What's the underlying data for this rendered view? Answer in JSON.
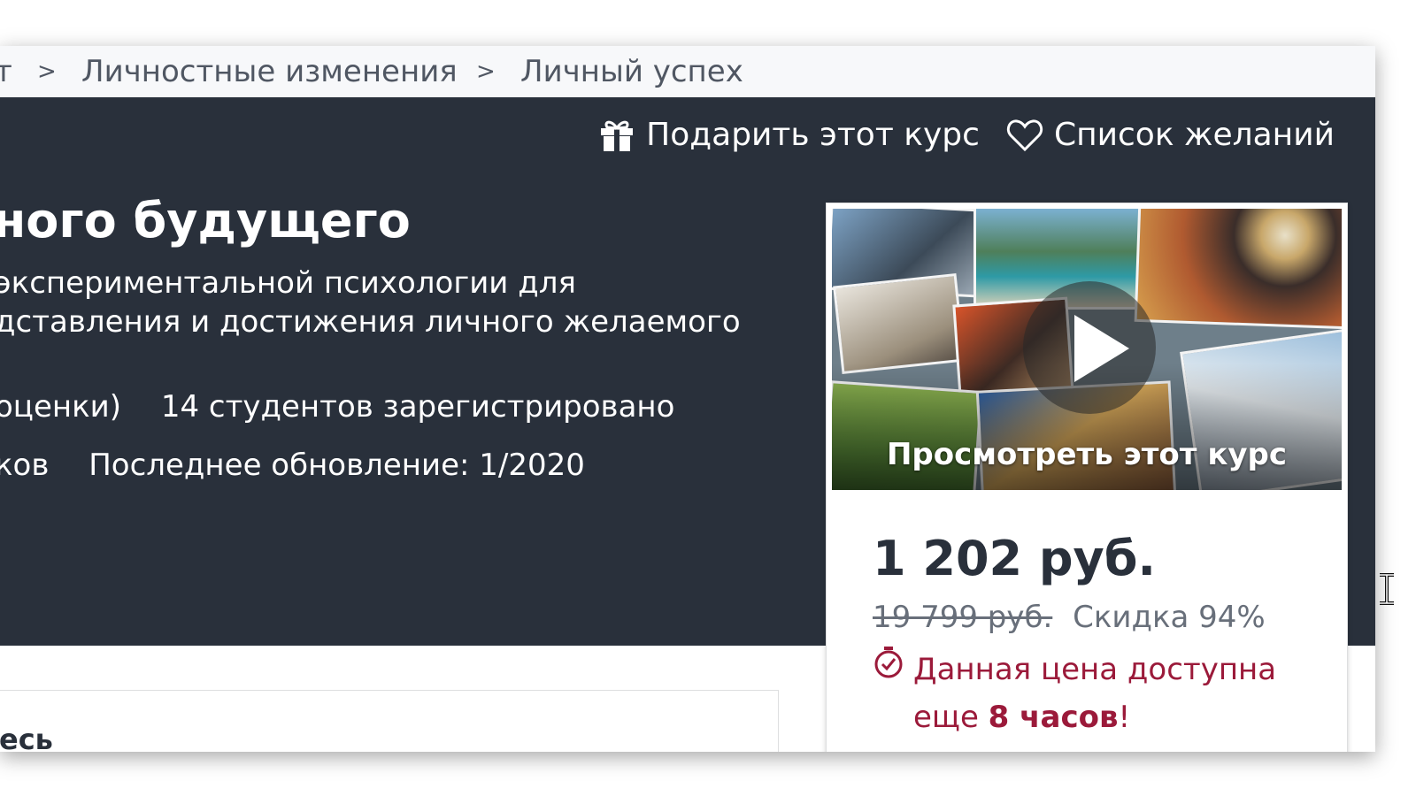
{
  "breadcrumb": {
    "items": [
      "т",
      "Личностные изменения",
      "Личный успех"
    ],
    "separator": ">"
  },
  "actions": {
    "gift_label": "Подарить этот курс",
    "wishlist_label": "Список желаний"
  },
  "course": {
    "title": "ного будущего",
    "subtitle_line1": "экспериментальной психологии для",
    "subtitle_line2": "дставления и достижения личного желаемого",
    "ratings_fragment": "оценки)",
    "students": "14 студентов зарегистрировано",
    "languages_fragment": "ков",
    "last_updated": "Последнее обновление: 1/2020"
  },
  "below": {
    "heading_fragment": "есь"
  },
  "sidebar": {
    "preview_label": "Просмотреть этот курс",
    "price": "1 202 руб.",
    "old_price": "19 799 руб.",
    "discount": "Скидка 94%",
    "timer_text_1": "Данная цена доступна",
    "timer_text_2_prefix": "еще ",
    "timer_bold": "8 часов",
    "timer_suffix": "!"
  },
  "colors": {
    "hero_bg": "#29303b",
    "breadcrumb_bg": "#f7f8fa",
    "urgency": "#9b1a3a",
    "muted": "#686f7a"
  },
  "icons": [
    "gift-icon",
    "heart-icon",
    "play-icon",
    "stopwatch-icon",
    "text-cursor-icon"
  ]
}
